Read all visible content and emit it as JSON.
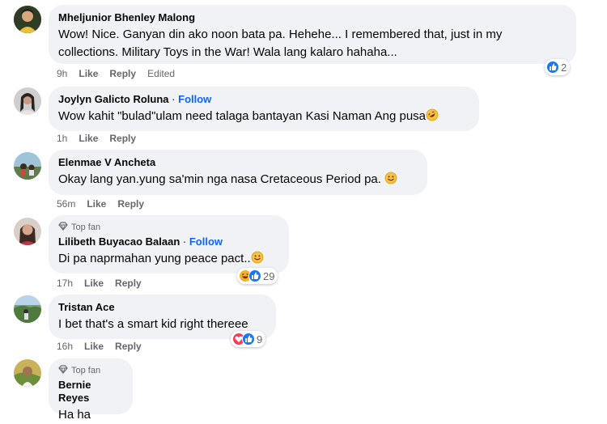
{
  "comments": [
    {
      "author": "Mheljunior Bhenley Malong",
      "text_lines": [
        "Wow! Nice. Ganyan din ako noon bata pa. Hehehe... I remembered that, just in my",
        "collections. Military Toys in the War! Wala lang kalaro hahaha..."
      ],
      "time": "9h",
      "like": "Like",
      "reply": "Reply",
      "edited": "Edited",
      "reaction_count": "2",
      "reactions": [
        "like-icon"
      ]
    },
    {
      "author": "Joylyn Galicto Roluna",
      "follow": "Follow",
      "text": "Wow kahit \"bulad\"ulam need talaga bantayan Kasi Naman Ang pusa",
      "emoji": "rofl-emoji",
      "time": "1h",
      "like": "Like",
      "reply": "Reply"
    },
    {
      "author": "Elenmae V Ancheta",
      "text": "Okay lang yan.yung sa'min nga nasa Cretaceous Period pa.",
      "emoji": "smile-emoji",
      "time": "56m",
      "like": "Like",
      "reply": "Reply"
    },
    {
      "badge": "Top fan",
      "author": "Lilibeth Buyacao Balaan",
      "follow": "Follow",
      "text": "Di pa naprmahan yung peace pact..",
      "emoji": "smile-emoji",
      "time": "17h",
      "like": "Like",
      "reply": "Reply",
      "reaction_count": "29",
      "reactions": [
        "haha-icon",
        "like-icon"
      ]
    },
    {
      "author": "Tristan Ace",
      "text": "I bet that's a smart kid right thereee",
      "time": "16h",
      "like": "Like",
      "reply": "Reply",
      "reaction_count": "9",
      "reactions": [
        "love-icon",
        "like-icon"
      ]
    },
    {
      "badge": "Top fan",
      "author": "Bernie Reyes",
      "text": "Ha ha"
    }
  ],
  "colors": {
    "bubble": "#f0f2f5",
    "follow": "#0866ff",
    "meta": "#65676b",
    "like": "#1877f2",
    "love": "#f33e58",
    "haha": "#f7b125"
  }
}
